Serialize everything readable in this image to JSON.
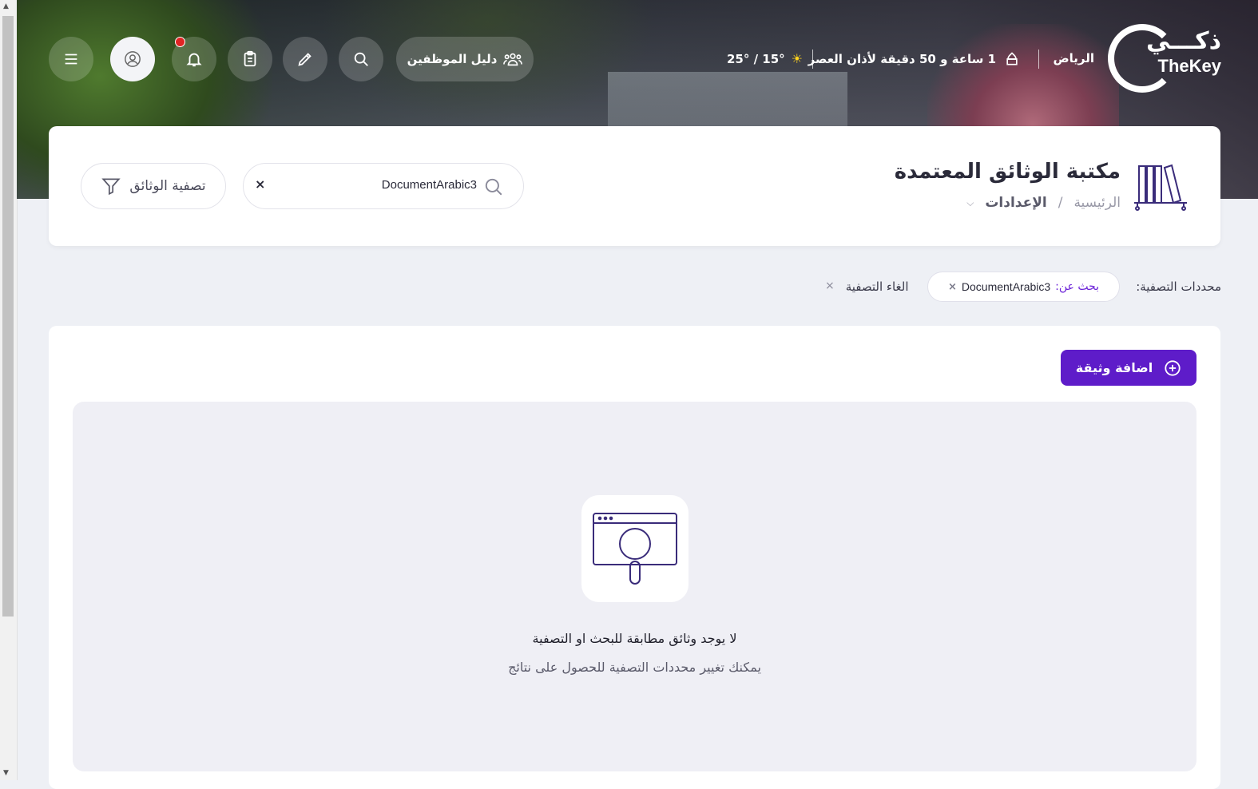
{
  "brand": {
    "logo_ar": "ذكـــي",
    "logo_en": "TheKey"
  },
  "header": {
    "city": "الرياض",
    "prayer_countdown": "1 ساعة و 50 دقيقة لأذان  العصر",
    "weather": "25° / 15°",
    "employee_guide": "دليل الموظفين",
    "icons": [
      "menu-icon",
      "user-icon",
      "bell-icon",
      "clipboard-icon",
      "pencil-icon",
      "search-icon",
      "people-icon",
      "mosque-icon",
      "sun-icon"
    ]
  },
  "page": {
    "title": "مكتبة الوثائق المعتمدة",
    "breadcrumb": {
      "home": "الرئيسية",
      "separator": "/",
      "current": "الإعدادات"
    }
  },
  "search": {
    "value": "DocumentArabic3",
    "clear": "×"
  },
  "filter_button": {
    "label": "تصفية الوثائق"
  },
  "filters": {
    "label": "محددات التصفية:",
    "chip_key": "بحث عن:",
    "chip_value": "DocumentArabic3",
    "chip_close": "×",
    "clear_label": "الغاء التصفية",
    "clear_icon": "×"
  },
  "actions": {
    "add_document": "اضافة وثيقة"
  },
  "empty_state": {
    "title": "لا يوجد وثائق مطابقة للبحث او التصفية",
    "subtitle": "يمكنك تغيير محددات التصفية للحصول على نتائج"
  },
  "colors": {
    "accent": "#5e1cc9",
    "notification": "#e02424",
    "empty_bg": "#efeff5"
  }
}
